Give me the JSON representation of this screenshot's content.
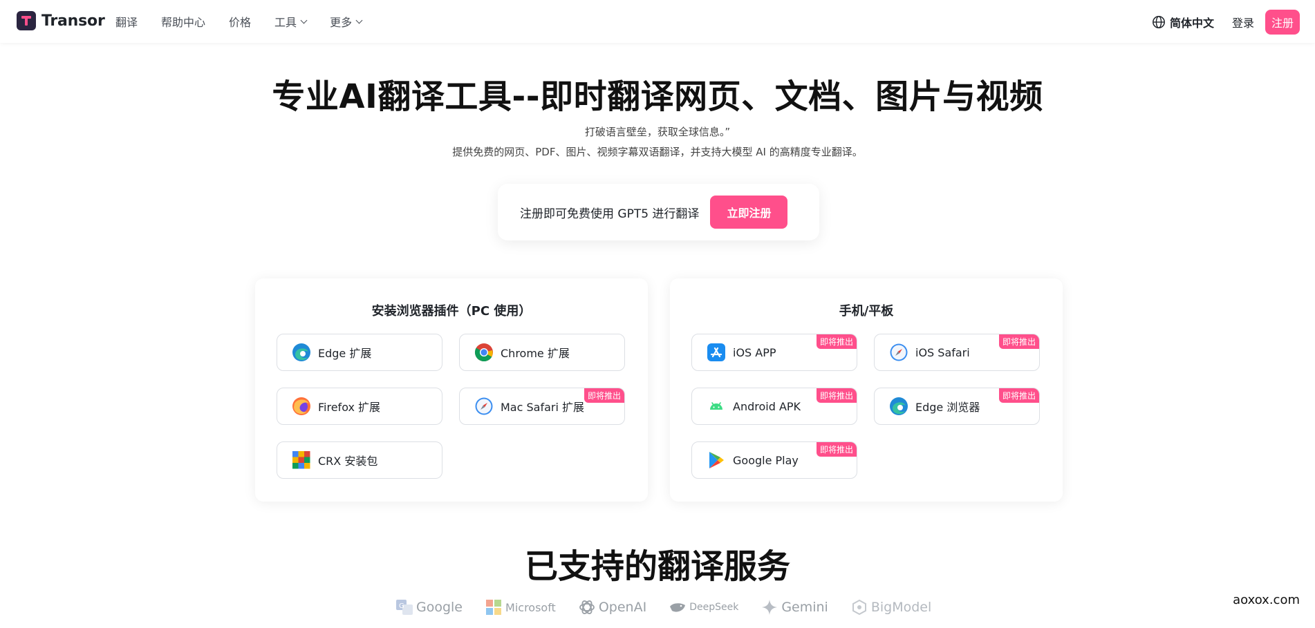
{
  "nav": {
    "brand": "Transor",
    "links": [
      {
        "label": "翻译"
      },
      {
        "label": "帮助中心"
      },
      {
        "label": "价格"
      },
      {
        "label": "工具"
      },
      {
        "label": "更多"
      }
    ],
    "language": "简体中文",
    "login": "登录",
    "signup": "注册"
  },
  "hero": {
    "title": "专业AI翻译工具--即时翻译网页、文档、图片与视频",
    "subtitle1": "打破语言壁垒，获取全球信息。”",
    "subtitle2": "提供免费的网页、PDF、图片、视频字幕双语翻译，并支持大模型 AI 的高精度专业翻译。",
    "cta_text": "注册即可免费使用 GPT5 进行翻译",
    "cta_button": "立即注册"
  },
  "browser_card": {
    "title": "安装浏览器插件（PC 使用）",
    "items": [
      {
        "label": "Edge 扩展",
        "icon": "edge-icon"
      },
      {
        "label": "Chrome 扩展",
        "icon": "chrome-icon"
      },
      {
        "label": "Firefox 扩展",
        "icon": "firefox-icon"
      },
      {
        "label": "Mac Safari 扩展",
        "icon": "safari-icon",
        "badge": "即将推出"
      },
      {
        "label": "CRX 安装包",
        "icon": "crx-package-icon"
      }
    ]
  },
  "mobile_card": {
    "title": "手机/平板",
    "items": [
      {
        "label": "iOS APP",
        "icon": "app-store-icon",
        "badge": "即将推出"
      },
      {
        "label": "iOS Safari",
        "icon": "safari-icon",
        "badge": "即将推出"
      },
      {
        "label": "Android APK",
        "icon": "android-icon",
        "badge": "即将推出"
      },
      {
        "label": "Edge 浏览器",
        "icon": "edge-icon",
        "badge": "即将推出"
      },
      {
        "label": "Google Play",
        "icon": "google-play-icon",
        "badge": "即将推出"
      }
    ]
  },
  "services": {
    "title": "已支持的翻译服务",
    "providers": [
      "Google",
      "Microsoft",
      "OpenAI",
      "DeepSeek",
      "Gemini",
      "BigModel"
    ]
  },
  "watermark": "aoxox.com",
  "colors": {
    "accent": "#ff4f8b",
    "text": "#1f2329",
    "muted": "#9aa0a6",
    "border": "#dcdfe4"
  }
}
